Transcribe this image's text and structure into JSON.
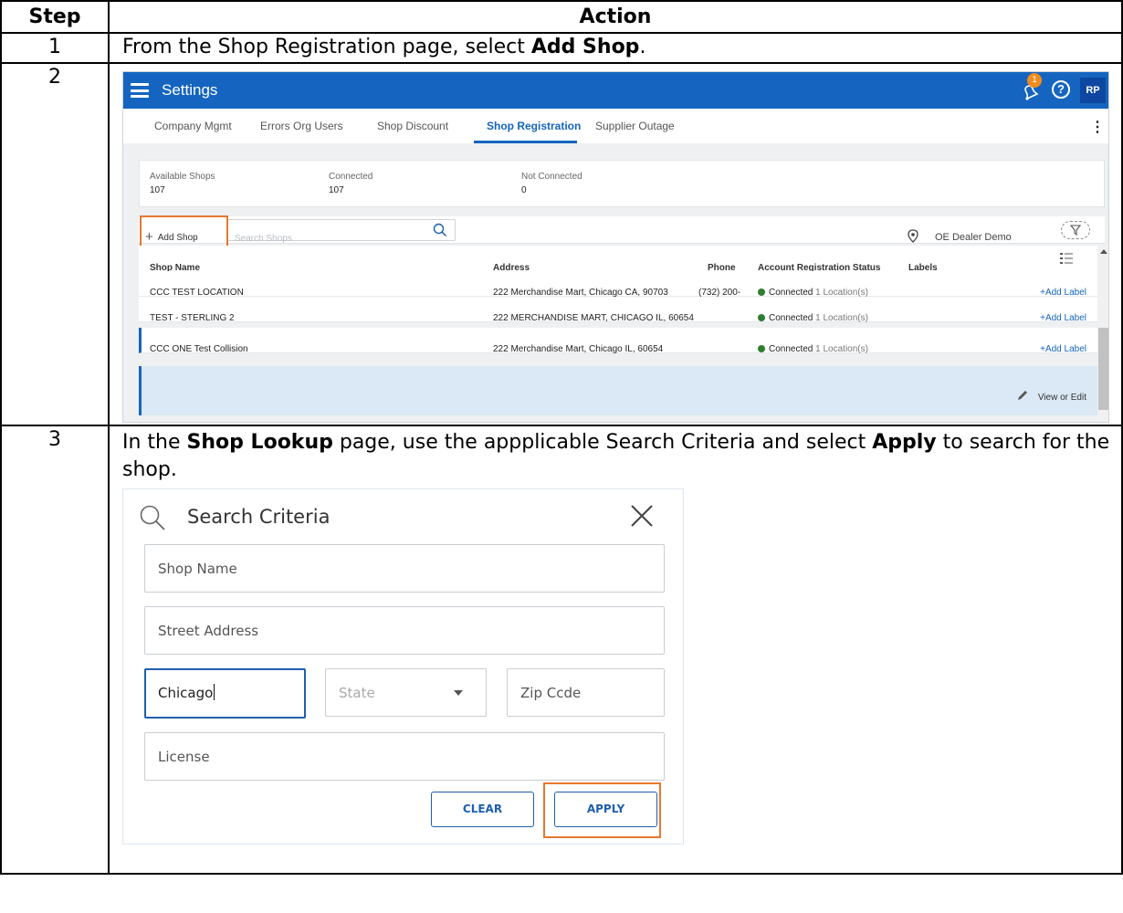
{
  "table": {
    "headers": {
      "step": "Step",
      "action": "Action"
    },
    "rows": [
      {
        "num": "1",
        "text_before": "From the Shop Registration page, select ",
        "bold": "Add Shop",
        "text_after": "."
      },
      {
        "num": "2"
      },
      {
        "num": "3",
        "text_before": "In the ",
        "bold": "Shop Lookup",
        "text_mid": " page, use the appplicable Search Criteria and select ",
        "bold2": "Apply",
        "text_after": " to search for the shop."
      }
    ]
  },
  "settings": {
    "title": "Settings",
    "notification_count": "1",
    "help_icon": "?",
    "avatar": "RP",
    "colors": {
      "topbar": "#1565c0",
      "accent": "#1565c0",
      "highlight": "#e8772e",
      "connected": "#2e7d32"
    },
    "tabs": [
      "Company Mgmt",
      "Errors",
      "Org Users",
      "Shop Discount",
      "Shop Registration",
      "Supplier Outage"
    ],
    "active_tab": "Shop Registration",
    "stats": [
      {
        "label": "Available Shops",
        "value": "107"
      },
      {
        "label": "Connected",
        "value": "107"
      },
      {
        "label": "Not Connected",
        "value": "0"
      }
    ],
    "add_shop": "Add Shop",
    "search_placeholder": "Search Shops",
    "location": "OE Dealer Demo",
    "columns": [
      "Shop Name",
      "Address",
      "Phone",
      "Account Registration Status",
      "Labels"
    ],
    "rows": [
      {
        "name": "CCC TEST LOCATION",
        "address": "222 Merchandise Mart, Chicago CA, 90703",
        "phone": "(732) 200-",
        "status": "Connected",
        "locations": "1 Location(s)",
        "label": "+Add Label"
      },
      {
        "name": "TEST - STERLING 2",
        "address": "222 MERCHANDISE MART, CHICAGO IL, 60654",
        "phone": "",
        "status": "Connected",
        "locations": "1 Location(s)",
        "label": "+Add Label"
      },
      {
        "name": "CCC ONE Test Collision",
        "address": "222 Merchandise Mart, Chicago IL, 60654",
        "phone": "",
        "status": "Connected",
        "locations": "1 Location(s)",
        "label": "+Add Label"
      }
    ],
    "view_edit": "View or Edit"
  },
  "search": {
    "title": "Search Criteria",
    "shop_name_placeholder": "Shop Name",
    "street_placeholder": "Street Address",
    "city_value": "Chicago",
    "state_placeholder": "State",
    "zip_placeholder": "Zip Ccde",
    "license_placeholder": "License",
    "clear": "CLEAR",
    "apply": "APPLY"
  }
}
